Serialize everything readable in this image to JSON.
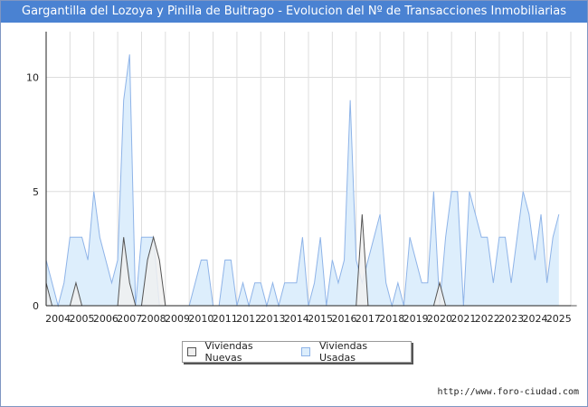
{
  "title": "Gargantilla del Lozoya y Pinilla de Buitrago - Evolucion del Nº de Transacciones Inmobiliarias",
  "source": "http://www.foro-ciudad.com",
  "colors": {
    "title_bg": "#4a82d2",
    "nuevas_fill": "#f0f0f0",
    "nuevas_line": "#555555",
    "usadas_fill": "#ddeefc",
    "usadas_line": "#8fb4e8",
    "grid": "#dddddd"
  },
  "chart_data": {
    "type": "area",
    "title": "Gargantilla del Lozoya y Pinilla de Buitrago - Evolucion del Nº de Transacciones Inmobiliarias",
    "xlabel": "",
    "ylabel": "",
    "x_ticks": [
      "2004",
      "2005",
      "2006",
      "2007",
      "2008",
      "2009",
      "2010",
      "2011",
      "2012",
      "2013",
      "2014",
      "2015",
      "2016",
      "2017",
      "2018",
      "2019",
      "2020",
      "2021",
      "2022",
      "2023",
      "2024",
      "2025"
    ],
    "y_ticks": [
      0,
      5,
      10
    ],
    "ylim": [
      0,
      12
    ],
    "x_range": [
      "2004 Q1",
      "2025 Q2"
    ],
    "periods_per_year": 4,
    "legend_position": "bottom-center",
    "grid": true,
    "series": [
      {
        "name": "Viviendas Nuevas",
        "values": [
          1,
          0,
          0,
          0,
          0,
          1,
          0,
          0,
          0,
          0,
          0,
          0,
          0,
          3,
          1,
          0,
          0,
          2,
          3,
          2,
          0,
          0,
          0,
          0,
          0,
          0,
          0,
          0,
          0,
          0,
          0,
          0,
          0,
          0,
          0,
          0,
          0,
          0,
          0,
          0,
          0,
          0,
          0,
          0,
          0,
          0,
          0,
          0,
          0,
          0,
          0,
          0,
          0,
          4,
          0,
          0,
          0,
          0,
          0,
          0,
          0,
          0,
          0,
          0,
          0,
          0,
          1,
          0,
          0,
          0,
          0,
          0,
          0,
          0,
          0,
          0,
          0,
          0,
          0,
          0,
          0,
          0,
          0,
          0,
          0,
          0,
          0,
          0,
          0,
          0
        ]
      },
      {
        "name": "Viviendas Usadas",
        "values": [
          2,
          1,
          0,
          1,
          3,
          3,
          3,
          2,
          5,
          3,
          2,
          1,
          2,
          9,
          11,
          0,
          3,
          3,
          3,
          0,
          0,
          0,
          0,
          0,
          0,
          1,
          2,
          2,
          0,
          0,
          2,
          2,
          0,
          1,
          0,
          1,
          1,
          0,
          1,
          0,
          1,
          1,
          1,
          3,
          0,
          1,
          3,
          0,
          2,
          1,
          2,
          9,
          2,
          1,
          2,
          3,
          4,
          1,
          0,
          1,
          0,
          3,
          2,
          1,
          1,
          5,
          0,
          3,
          5,
          5,
          0,
          5,
          4,
          3,
          3,
          1,
          3,
          3,
          1,
          3,
          5,
          4,
          2,
          4,
          1,
          3,
          4
        ]
      }
    ]
  },
  "legend": {
    "nuevas_label": "Viviendas Nuevas",
    "usadas_label": "Viviendas Usadas"
  }
}
